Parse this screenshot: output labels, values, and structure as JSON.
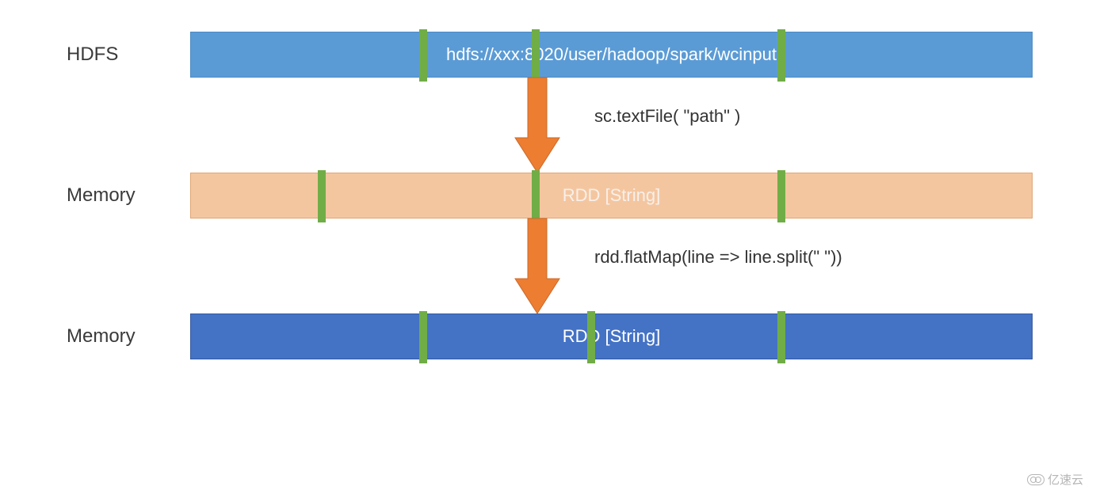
{
  "rows": [
    {
      "label": "HDFS",
      "bar_text": "hdfs://xxx:8020/user/hadoop/spark/wcinput",
      "style": "bar-hdfs",
      "divider_positions": [
        288,
        430,
        740
      ]
    },
    {
      "label": "Memory",
      "bar_text": "RDD [String]",
      "style": "bar-mem1",
      "divider_positions": [
        160,
        430,
        740
      ]
    },
    {
      "label": "Memory",
      "bar_text": "RDD [String]",
      "style": "bar-mem2",
      "divider_positions": [
        288,
        500,
        740
      ]
    }
  ],
  "arrows": [
    {
      "label": "sc.textFile( \"path\" )"
    },
    {
      "label": "rdd.flatMap(line => line.split(\" \"))"
    }
  ],
  "colors": {
    "hdfs_bar": "#5b9bd5",
    "memory_bar_light": "#f4c6a0",
    "memory_bar_dark": "#4472c4",
    "divider": "#70ad47",
    "arrow": "#ed7d31"
  },
  "watermark": "亿速云"
}
